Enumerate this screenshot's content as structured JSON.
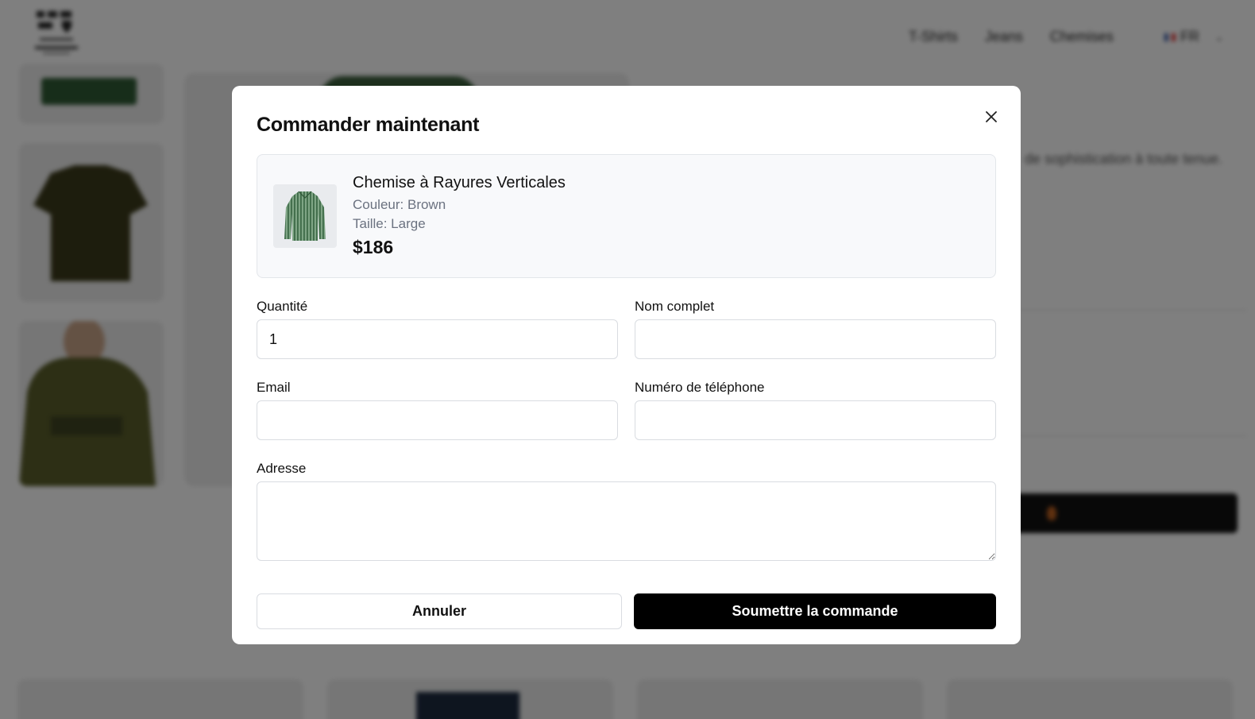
{
  "header": {
    "nav": [
      "T-Shirts",
      "Jeans",
      "Chemises"
    ],
    "language": "FR"
  },
  "background": {
    "description_snippet": "de sophistication à toute tenue."
  },
  "modal": {
    "title": "Commander maintenant",
    "product": {
      "name": "Chemise à Rayures Verticales",
      "color": "Couleur: Brown",
      "size": "Taille: Large",
      "price": "$186"
    },
    "fields": {
      "quantity_label": "Quantité",
      "quantity_value": "1",
      "fullname_label": "Nom complet",
      "fullname_value": "",
      "email_label": "Email",
      "email_value": "",
      "phone_label": "Numéro de téléphone",
      "phone_value": "",
      "address_label": "Adresse",
      "address_value": ""
    },
    "cancel_label": "Annuler",
    "submit_label": "Soumettre la commande"
  },
  "colors": {
    "accent": "#000000",
    "overlay": "#808080",
    "product_stripe": "#4a7a55"
  }
}
